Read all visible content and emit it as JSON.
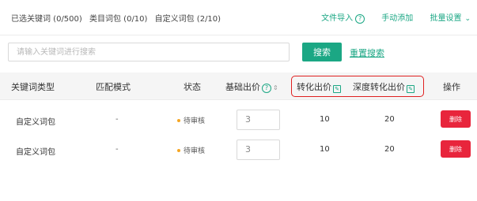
{
  "stats": {
    "selected_keywords": "已选关键词 (0/500)",
    "category_words": "类目词包 (0/10)",
    "custom_words": "自定义词包 (2/10)"
  },
  "actions": {
    "file_import": "文件导入",
    "help_icon": "?",
    "manual_add": "手动添加",
    "batch_settings": "批量设置",
    "chevron": "⌄"
  },
  "search": {
    "placeholder": "请输入关键词进行搜索",
    "button": "搜索",
    "reset": "重置搜索"
  },
  "table": {
    "headers": {
      "type": "关键词类型",
      "match": "匹配模式",
      "status": "状态",
      "base_bid": "基础出价",
      "conversion_bid": "转化出价",
      "deep_conversion_bid": "深度转化出价",
      "operation": "操作"
    },
    "rows": [
      {
        "type": "自定义词包",
        "match": "-",
        "status": "待审核",
        "bid": "3",
        "conversion": "10",
        "deep": "20",
        "action": "删除"
      },
      {
        "type": "自定义词包",
        "match": "-",
        "status": "待审核",
        "bid": "3",
        "conversion": "10",
        "deep": "20",
        "action": "删除"
      }
    ]
  },
  "colors": {
    "accent": "#1ba784",
    "danger": "#e8253c",
    "highlight": "#e02020",
    "pending_dot": "#f5a623"
  }
}
